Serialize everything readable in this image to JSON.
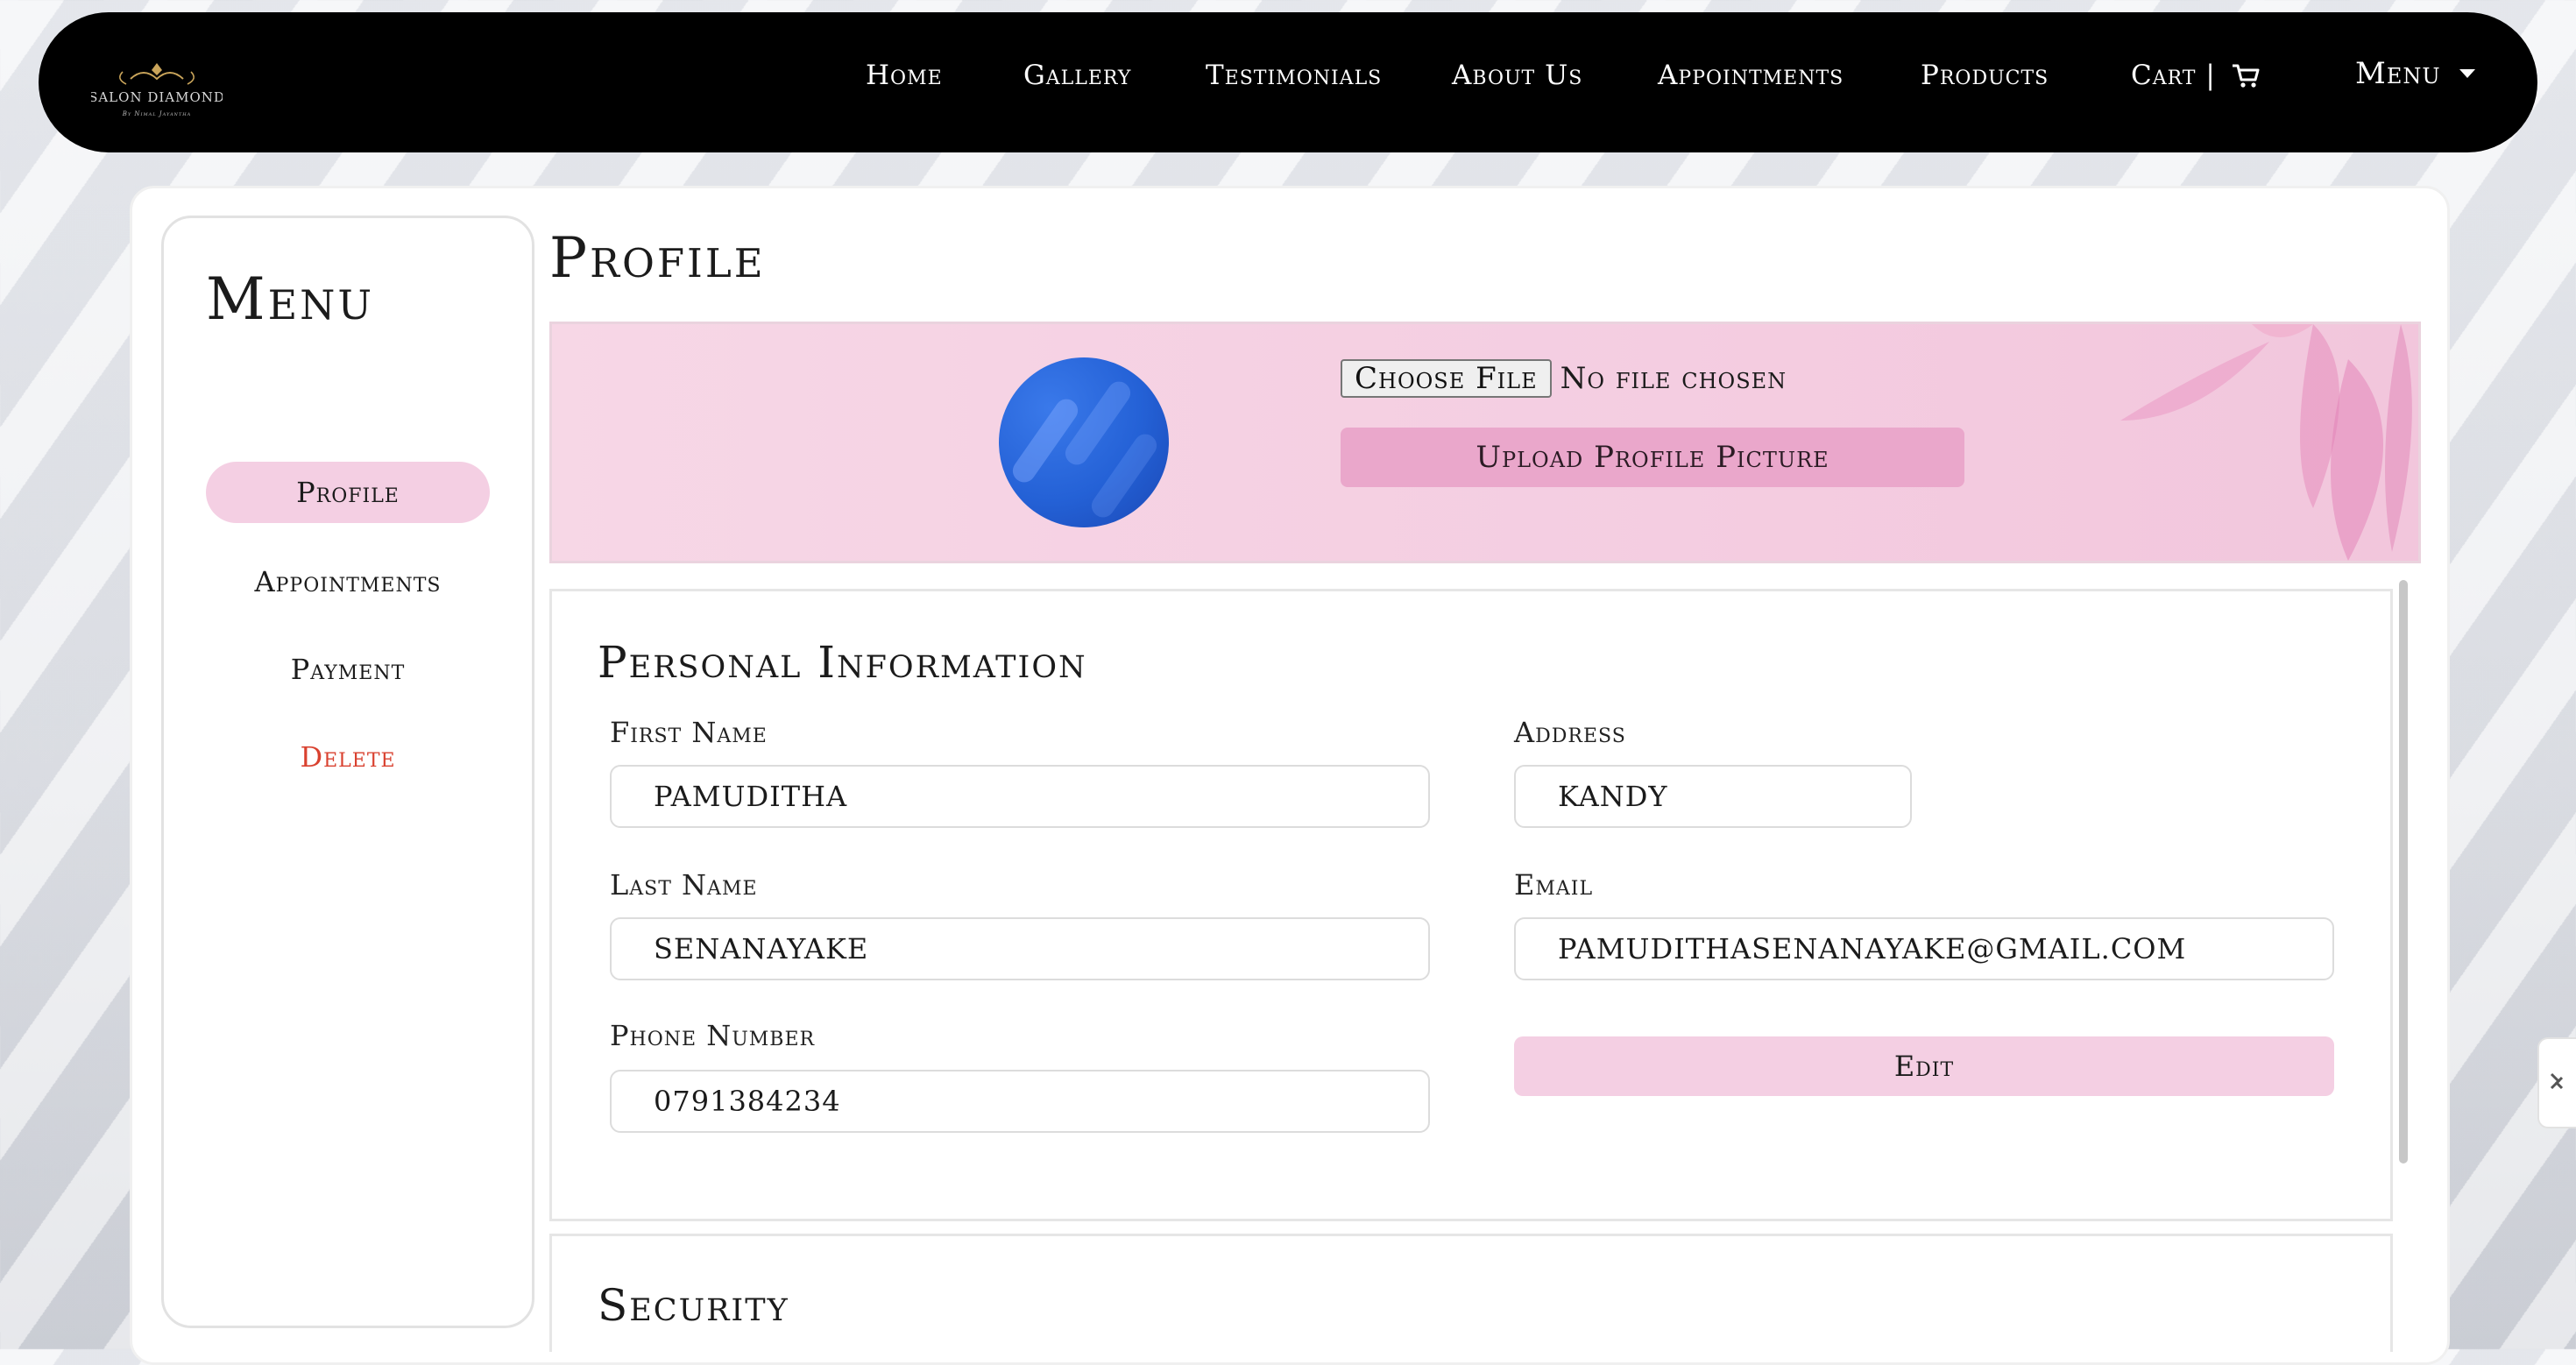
{
  "nav": {
    "logo_text": "SALON DIAMOND",
    "logo_tagline": "By Nimal Jayantha",
    "links": [
      "Home",
      "Gallery",
      "Testimonials",
      "About Us",
      "Appointments",
      "Products"
    ],
    "cart_label": "Cart |",
    "menu_label": "Menu"
  },
  "sidebar": {
    "title": "Menu",
    "items": [
      "Profile",
      "Appointments",
      "Payment",
      "Delete"
    ],
    "active_item": "Profile"
  },
  "page": {
    "title": "Profile"
  },
  "upload": {
    "choose_file_label": "Choose File",
    "no_file_text": "No file chosen",
    "upload_button_label": "Upload Profile Picture"
  },
  "personal_info": {
    "title": "Personal Information",
    "first_name": {
      "label": "First Name",
      "value": "PAMUDITHA"
    },
    "last_name": {
      "label": "Last Name",
      "value": "SENANAYAKE"
    },
    "phone": {
      "label": "Phone Number",
      "value": "0791384234"
    },
    "address": {
      "label": "Address",
      "value": "KANDY"
    },
    "email": {
      "label": "Email",
      "value": "PAMUDITHASENANAYAKE@GMAIL.COM"
    },
    "edit_button_label": "Edit"
  },
  "security": {
    "title": "Security"
  },
  "colors": {
    "nav_bg": "#000000",
    "accent_pink": "#f4cfe3",
    "upload_pink": "#eaa7cb",
    "danger": "#d9412f",
    "avatar_blue": "#2461d6"
  },
  "icons": [
    "cart-icon",
    "caret-down-icon",
    "avatar-icon",
    "side-tab-icon"
  ]
}
